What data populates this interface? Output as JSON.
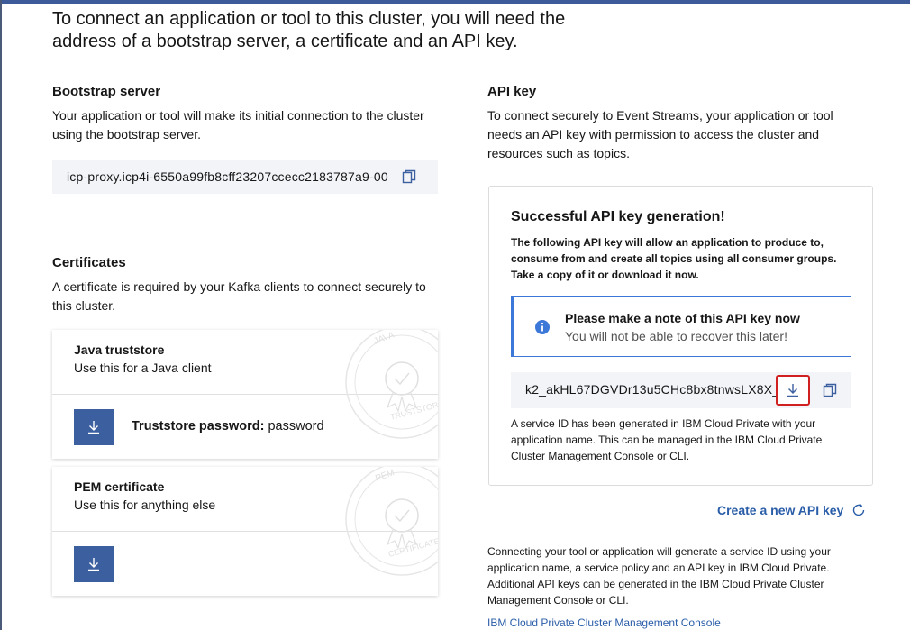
{
  "intro": "To connect an application or tool to this cluster, you will need the address of a bootstrap server, a certificate and an API key.",
  "bootstrap": {
    "heading": "Bootstrap server",
    "description": "Your application or tool will make its initial connection to the cluster using the bootstrap server.",
    "address": "icp-proxy.icp4i-6550a99fb8cff23207ccecc2183787a9-00"
  },
  "certificates": {
    "heading": "Certificates",
    "description": "A certificate is required by your Kafka clients to connect securely to this cluster.",
    "java": {
      "title": "Java truststore",
      "subtitle": "Use this for a Java client",
      "seal_text": "JAVA",
      "seal_text2": "TRUSTSTORE",
      "password_label": "Truststore password:",
      "password_value": "password"
    },
    "pem": {
      "title": "PEM certificate",
      "subtitle": "Use this for anything else",
      "seal_text": "PEM",
      "seal_text2": "CERTIFICATE"
    }
  },
  "api_key": {
    "heading": "API key",
    "description": "To connect securely to Event Streams, your application or tool needs an API key with permission to access the cluster and resources such as topics.",
    "panel": {
      "title": "Successful API key generation!",
      "description": "The following API key will allow an application to produce to, consume from and create all topics using all consumer groups. Take a copy of it or download it now.",
      "notice_title": "Please make a note of this API key now",
      "notice_subtitle": "You will not be able to recover this later!",
      "key_value": "k2_akHL67DGVDr13u5CHc8bx8tnwsLX8X_",
      "note": "A service ID has been generated in IBM Cloud Private with your application name. This can be managed in the IBM Cloud Private Cluster Management Console or CLI."
    },
    "create_link": "Create a new API key",
    "bottom_text": "Connecting your tool or application will generate a service ID using your application name, a service policy and an API key in IBM Cloud Private. Additional API keys can be generated in the IBM Cloud Private Cluster Management Console or CLI.",
    "console_link": "IBM Cloud Private Cluster Management Console"
  },
  "colors": {
    "accent": "#3c5fa0",
    "link": "#2a5da8",
    "notice_border": "#3c78d8",
    "highlight": "#d02020"
  }
}
